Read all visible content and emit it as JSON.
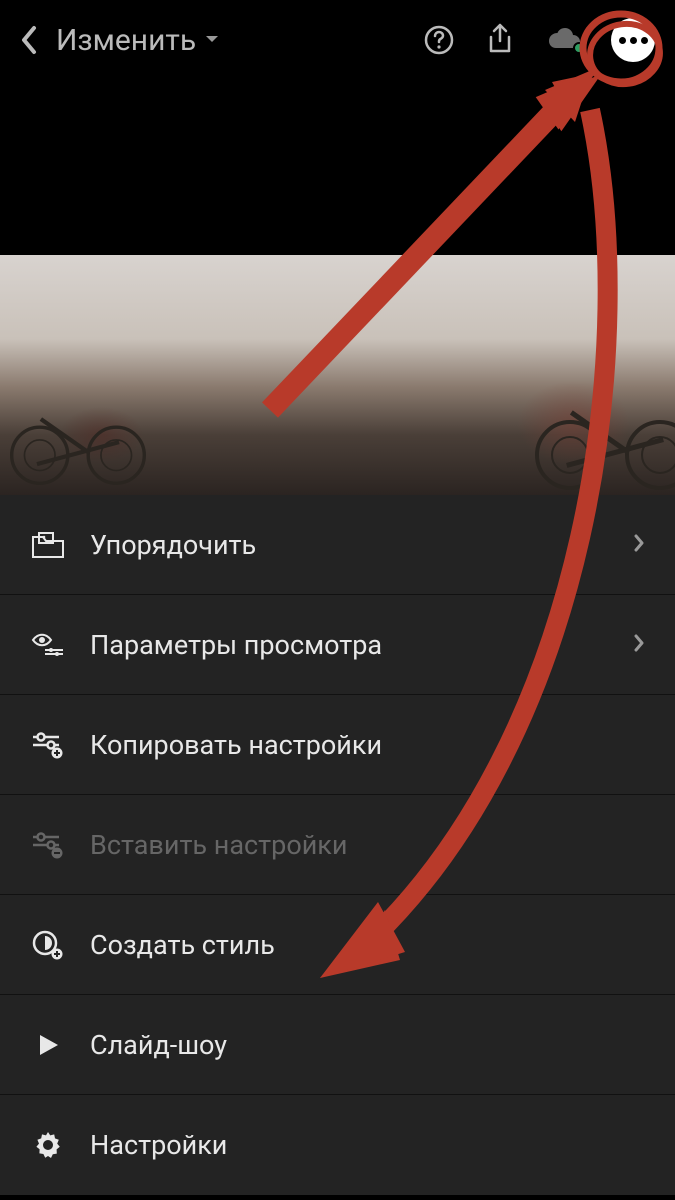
{
  "header": {
    "title": "Изменить"
  },
  "menu": {
    "items": [
      {
        "label": "Упорядочить",
        "hasChevron": true,
        "disabled": false,
        "icon": "folder-image-icon"
      },
      {
        "label": "Параметры просмотра",
        "hasChevron": true,
        "disabled": false,
        "icon": "eye-settings-icon"
      },
      {
        "label": "Копировать настройки",
        "hasChevron": false,
        "disabled": false,
        "icon": "sliders-plus-icon"
      },
      {
        "label": "Вставить настройки",
        "hasChevron": false,
        "disabled": true,
        "icon": "sliders-minus-icon"
      },
      {
        "label": "Создать стиль",
        "hasChevron": false,
        "disabled": false,
        "icon": "preset-add-icon"
      },
      {
        "label": "Слайд-шоу",
        "hasChevron": false,
        "disabled": false,
        "icon": "play-icon"
      },
      {
        "label": "Настройки",
        "hasChevron": false,
        "disabled": false,
        "icon": "gear-icon"
      }
    ]
  },
  "annotation": {
    "color": "#b83a2a"
  }
}
